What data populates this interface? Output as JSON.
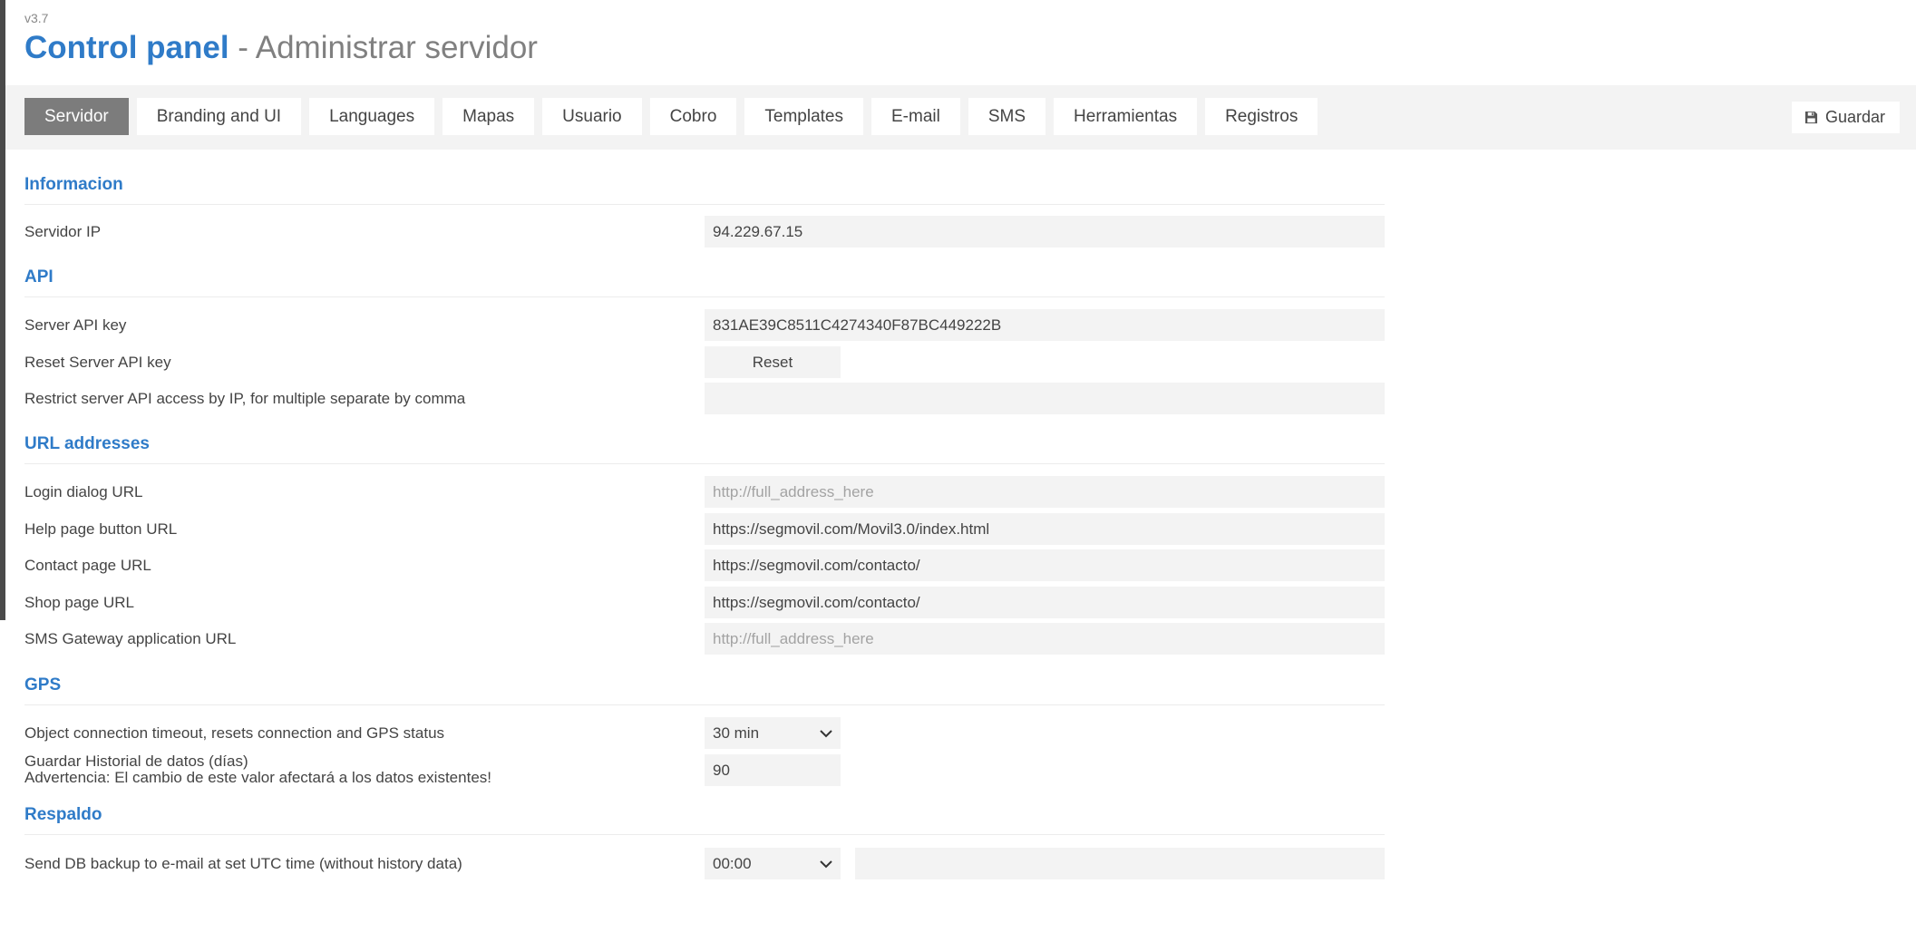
{
  "app": {
    "version": "v3.7",
    "title": "Control panel",
    "subtitle": "- Administrar servidor"
  },
  "tabs": [
    {
      "label": "Servidor",
      "active": true
    },
    {
      "label": "Branding and UI",
      "active": false
    },
    {
      "label": "Languages",
      "active": false
    },
    {
      "label": "Mapas",
      "active": false
    },
    {
      "label": "Usuario",
      "active": false
    },
    {
      "label": "Cobro",
      "active": false
    },
    {
      "label": "Templates",
      "active": false
    },
    {
      "label": "E-mail",
      "active": false
    },
    {
      "label": "SMS",
      "active": false
    },
    {
      "label": "Herramientas",
      "active": false
    },
    {
      "label": "Registros",
      "active": false
    }
  ],
  "toolbar": {
    "save_label": "Guardar",
    "save_icon": "floppy-disk-icon"
  },
  "sections": {
    "info": {
      "title": "Informacion",
      "server_ip_label": "Servidor IP",
      "server_ip_value": "94.229.67.15"
    },
    "api": {
      "title": "API",
      "key_label": "Server API key",
      "key_value": "831AE39C8511C4274340F87BC449222B",
      "reset_label": "Reset Server API key",
      "reset_button": "Reset",
      "restrict_label": "Restrict server API access by IP, for multiple separate by comma",
      "restrict_value": ""
    },
    "urls": {
      "title": "URL addresses",
      "login_label": "Login dialog URL",
      "login_placeholder": "http://full_address_here",
      "help_label": "Help page button URL",
      "help_value": "https://segmovil.com/Movil3.0/index.html",
      "contact_label": "Contact page URL",
      "contact_value": "https://segmovil.com/contacto/",
      "shop_label": "Shop page URL",
      "shop_value": "https://segmovil.com/contacto/",
      "sms_label": "SMS Gateway application URL",
      "sms_placeholder": "http://full_address_here"
    },
    "gps": {
      "title": "GPS",
      "timeout_label": "Object connection timeout, resets connection and GPS status",
      "timeout_value": "30 min",
      "history_label": "Guardar Historial de datos (días)",
      "history_warning": "Advertencia: El cambio de este valor afectará a los datos existentes!",
      "history_value": "90"
    },
    "backup": {
      "title": "Respaldo",
      "send_label": "Send DB backup to e-mail at set UTC time (without history data)",
      "time_value": "00:00",
      "email_value": ""
    }
  },
  "colors": {
    "accent": "#2f7bc8",
    "active_tab": "#7c7c7c",
    "field_bg": "#f3f3f3"
  }
}
